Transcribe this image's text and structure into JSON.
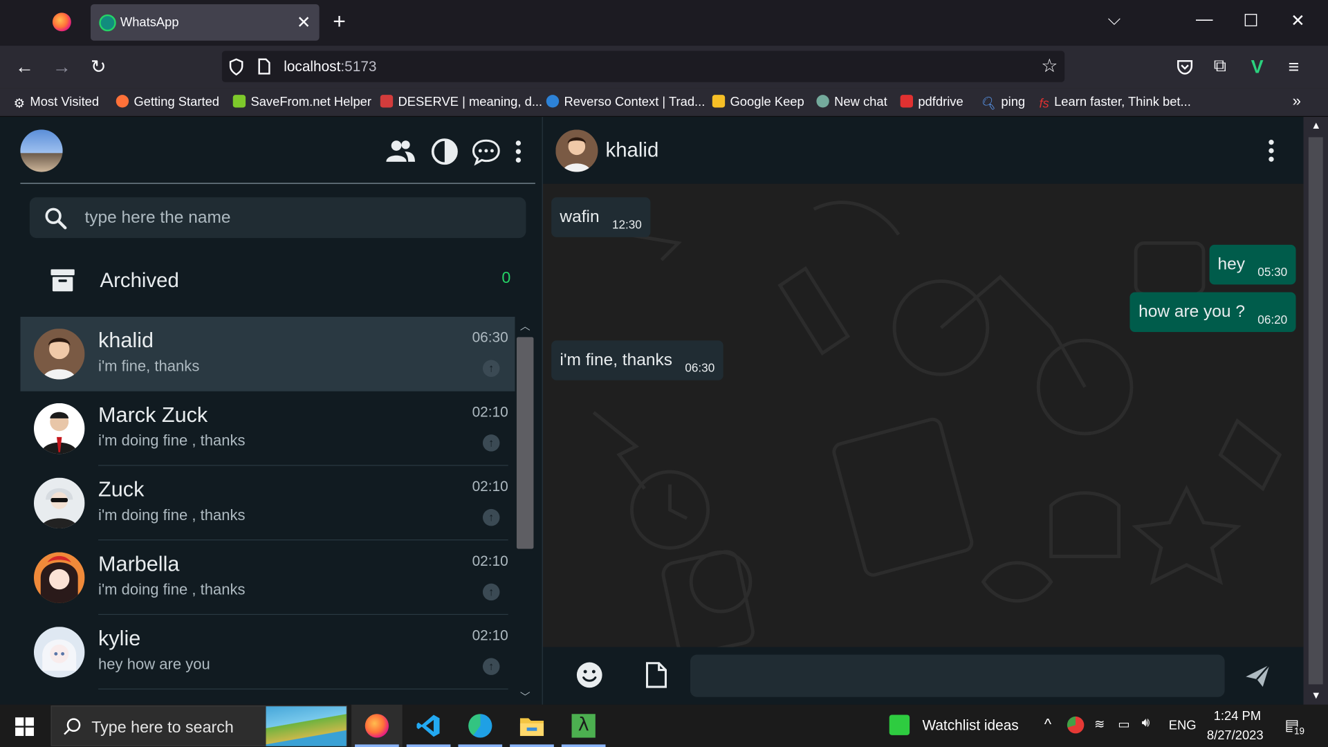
{
  "browser": {
    "tab_title": "WhatsApp",
    "url_host": "localhost",
    "url_port": ":5173",
    "bookmarks": [
      {
        "label": "Most Visited",
        "color": "#bfbfc9"
      },
      {
        "label": "Getting Started",
        "color": "#ff7139"
      },
      {
        "label": "SaveFrom.net Helper",
        "color": "#7ec92b"
      },
      {
        "label": "DESERVE | meaning, d...",
        "color": "#d23c3c"
      },
      {
        "label": "Reverso Context | Trad...",
        "color": "#2d82d7"
      },
      {
        "label": "Google Keep",
        "color": "#f6bf26"
      },
      {
        "label": "New chat",
        "color": "#74aa9c"
      },
      {
        "label": "pdfdrive",
        "color": "#e03131"
      },
      {
        "label": "ping",
        "color": "#5b9cf6"
      },
      {
        "label": "Learn faster, Think bet...",
        "color": "#e03131"
      }
    ]
  },
  "sidebar": {
    "search_placeholder": "type here the name",
    "archived_label": "Archived",
    "archived_count": "0",
    "chats": [
      {
        "name": "khalid",
        "last_message": "i'm fine, thanks",
        "time": "06:30",
        "active": true,
        "avatar_color": "#7a5a44"
      },
      {
        "name": "Marck Zuck",
        "last_message": "i'm doing fine , thanks",
        "time": "02:10",
        "active": false,
        "avatar_color": "#e8c6a8"
      },
      {
        "name": "Zuck",
        "last_message": "i'm doing fine , thanks",
        "time": "02:10",
        "active": false,
        "avatar_color": "#cfd6dc"
      },
      {
        "name": "Marbella",
        "last_message": "i'm doing fine , thanks",
        "time": "02:10",
        "active": false,
        "avatar_color": "#e0552f"
      },
      {
        "name": "kylie",
        "last_message": "hey how are you",
        "time": "02:10",
        "active": false,
        "avatar_color": "#c9d6e6"
      }
    ]
  },
  "conversation": {
    "contact_name": "khalid",
    "messages": [
      {
        "text": "wafin",
        "time": "12:30",
        "direction": "in"
      },
      {
        "text": "hey",
        "time": "05:30",
        "direction": "out"
      },
      {
        "text": "how are you ?",
        "time": "06:20",
        "direction": "out"
      },
      {
        "text": "i'm fine, thanks",
        "time": "06:30",
        "direction": "in"
      }
    ],
    "accent_out": "#005c4b",
    "accent_in": "#202c33"
  },
  "taskbar": {
    "search_placeholder": "Type here to search",
    "widget_label": "Watchlist ideas",
    "language": "ENG",
    "time": "1:24 PM",
    "date": "8/27/2023",
    "notification_count": "19"
  }
}
